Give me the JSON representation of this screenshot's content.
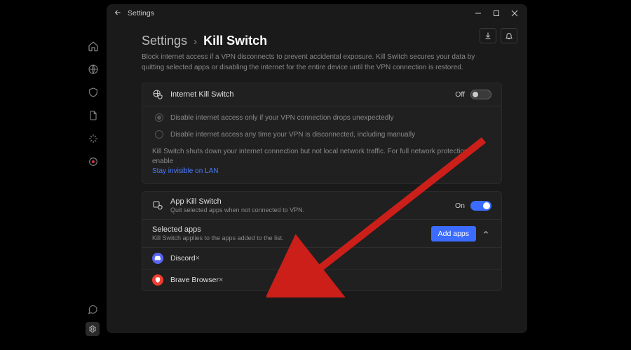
{
  "titlebar": {
    "title": "Settings"
  },
  "breadcrumb": {
    "parent": "Settings",
    "current": "Kill Switch"
  },
  "description": "Block internet access if a VPN disconnects to prevent accidental exposure. Kill Switch secures your data by quitting selected apps or disabling the internet for the entire device until the VPN connection is restored.",
  "internet_ks": {
    "title": "Internet Kill Switch",
    "state": "Off",
    "on": false,
    "options": [
      {
        "label": "Disable internet access only if your VPN connection drops unexpectedly",
        "selected": true
      },
      {
        "label": "Disable internet access any time your VPN is disconnected, including manually",
        "selected": false
      }
    ],
    "note_line": "Kill Switch shuts down your internet connection but not local network traffic. For full network protection, enable",
    "note_link": "Stay invisible on LAN"
  },
  "app_ks": {
    "title": "App Kill Switch",
    "subtitle": "Quit selected apps when not connected to VPN.",
    "state": "On",
    "on": true
  },
  "selected_apps": {
    "label": "Selected apps",
    "sub": "Kill Switch applies to the apps added to the list.",
    "add_button": "Add apps",
    "items": [
      {
        "name": "Discord",
        "icon": "discord"
      },
      {
        "name": "Brave Browser",
        "icon": "brave"
      }
    ]
  }
}
